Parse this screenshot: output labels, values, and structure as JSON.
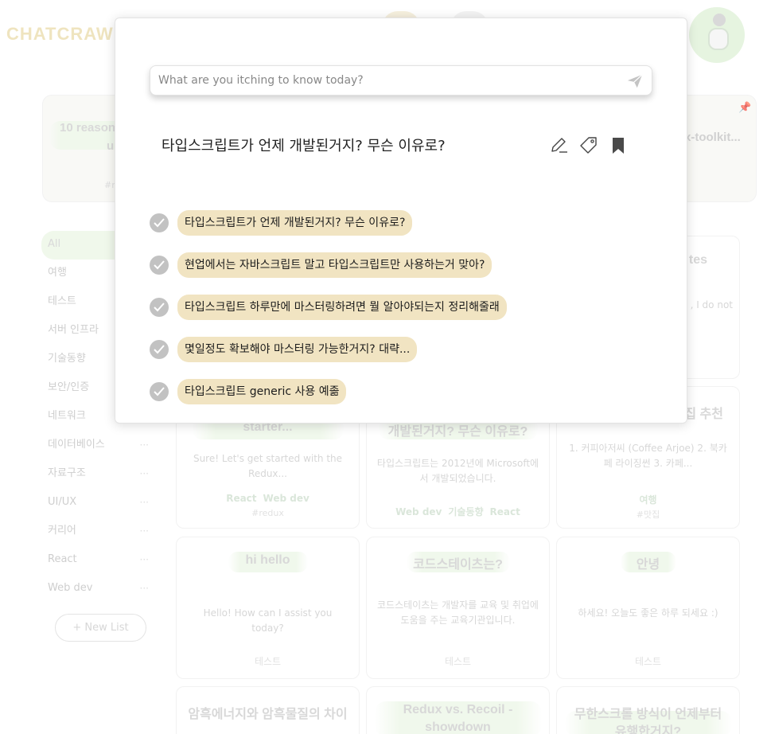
{
  "app": {
    "logo": "CHATCRAW"
  },
  "featured": {
    "left_title_line1": "10 reason",
    "left_title_line2": "u",
    "left_tag": "#r",
    "right_title": "x-toolkit..."
  },
  "sidebar": {
    "items": [
      {
        "label": "All"
      },
      {
        "label": "여행"
      },
      {
        "label": "테스트"
      },
      {
        "label": "서버 인프라"
      },
      {
        "label": "기술동향"
      },
      {
        "label": "보안/인증"
      },
      {
        "label": "네트워크"
      },
      {
        "label": "데이터베이스"
      },
      {
        "label": "자료구조"
      },
      {
        "label": "UI/UX"
      },
      {
        "label": "커리어"
      },
      {
        "label": "React"
      },
      {
        "label": "Web dev"
      }
    ],
    "more_label": "···",
    "new_list_label": "+ New List"
  },
  "cards": {
    "c1": {
      "title": "starter...",
      "text": "Sure! Let's get started with the Redux...",
      "tags": [
        "React",
        "Web dev"
      ],
      "hash": "#redux"
    },
    "c2": {
      "title": "개발된거지? 무슨 이유로?",
      "text": "타입스크립트는 2012년에 Microsoft에서 개발되었습니다.",
      "tags": [
        "Web dev",
        "기술동향",
        "React"
      ]
    },
    "c3": {
      "title": "집 추천",
      "text": "1. 커피아저씨 (Coffee Arjoe) 2. 북카페 라이징썬 3. 카페...",
      "tags": [
        "여행"
      ],
      "hash": "#맛집"
    },
    "c4": {
      "title": "tes",
      "text": ", I do not"
    },
    "c5": {
      "title": "hi hello",
      "text": "Hello! How can I assist you today?",
      "tags": [
        "테스트"
      ]
    },
    "c6": {
      "title": "코드스테이츠는?",
      "text": "코드스테이츠는 개발자를 교육 및 취업에 도움을 주는 교육기관입니다.",
      "tags": [
        "테스트"
      ]
    },
    "c7": {
      "title": "안녕",
      "text": "하세요! 오늘도 좋은 하루 되세요 :)",
      "tags": [
        "테스트"
      ]
    },
    "c8": {
      "title": "암흑에너지와 암흑물질의 차이"
    },
    "c9": {
      "title_line1": "Redux vs. Recoil -",
      "title_line2": "showdown"
    },
    "c10": {
      "title_line1": "무한스크롤 방식이 언제부터",
      "title_line2": "유행한거지?"
    }
  },
  "modal": {
    "search_placeholder": "What are you itching to know today?",
    "question": "타입스크립트가 언제 개발된거지? 무슨 이유로?",
    "icons": {
      "send": "send-icon",
      "edit": "pencil-icon",
      "tag": "tag-icon",
      "bookmark": "bookmark-icon",
      "check": "check-icon"
    },
    "history": [
      {
        "text": "타입스크립트가 언제 개발된거지? 무슨 이유로?"
      },
      {
        "text": "현업에서는 자바스크립트 말고 타입스크립트만 사용하는거 맞아?"
      },
      {
        "text": "타입스크립트 하루만에 마스터링하려면 뭘 알아야되는지 정리해줄래"
      },
      {
        "text": "몇일정도 확보해야 마스터링 가능한거지? 대략..."
      },
      {
        "text": "타입스크립트 generic 사용 예졺"
      }
    ]
  },
  "colors": {
    "pill": "#f1e4c2",
    "check": "#c2c2c2",
    "accent_green": "#eaf5e4",
    "logo": "#e8d9a4"
  }
}
